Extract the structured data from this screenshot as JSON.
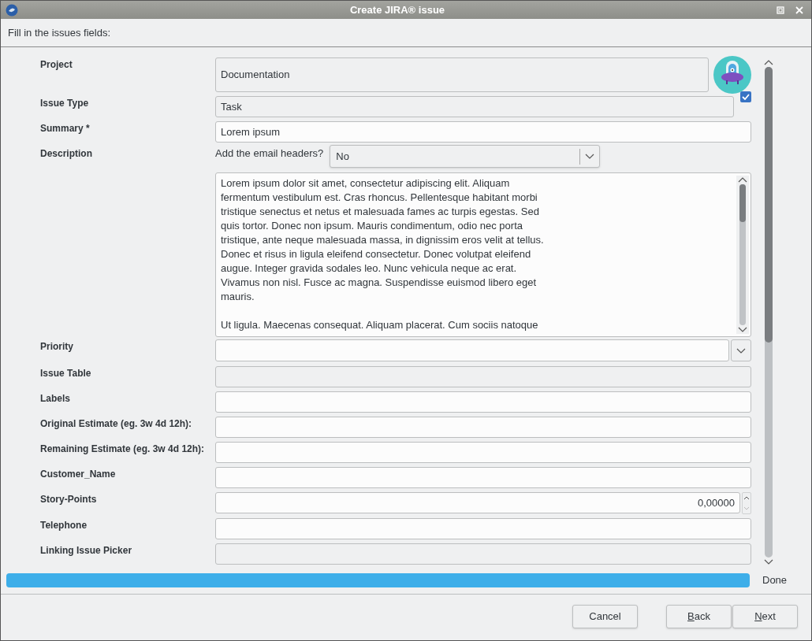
{
  "window": {
    "title": "Create JIRA® issue"
  },
  "instruction": "Fill in the issues fields:",
  "fields": [
    {
      "label": "Project",
      "kind": "readonly_tall",
      "value": "Documentation"
    },
    {
      "label": "Issue Type",
      "kind": "readonly_check",
      "value": "Task",
      "checked": true
    },
    {
      "label": "Summary *",
      "kind": "text",
      "value": "Lorem ipsum"
    },
    {
      "label": "Description",
      "kind": "description",
      "headers_label": "Add the email headers?",
      "headers_value": "No",
      "paragraphs": [
        "Lorem ipsum dolor sit amet, consectetur adipiscing elit. Aliquam fermentum vestibulum est. Cras rhoncus. Pellentesque habitant morbi tristique senectus et netus et malesuada fames ac turpis egestas. Sed quis tortor. Donec non ipsum. Mauris condimentum, odio nec porta tristique, ante neque malesuada massa, in dignissim eros velit at tellus. Donec et risus in ligula eleifend consectetur. Donec volutpat eleifend augue. Integer gravida sodales leo. Nunc vehicula neque ac erat. Vivamus non nisl. Fusce ac magna. Suspendisse euismod libero eget mauris.",
        "Ut ligula. Maecenas consequat. Aliquam placerat. Cum sociis natoque"
      ]
    },
    {
      "label": "Priority",
      "kind": "combo"
    },
    {
      "label": "Issue Table",
      "kind": "disabled"
    },
    {
      "label": "Labels",
      "kind": "text"
    },
    {
      "label": "Original Estimate (eg. 3w 4d 12h):",
      "kind": "text"
    },
    {
      "label": "Remaining Estimate (eg. 3w 4d 12h):",
      "kind": "text"
    },
    {
      "label": "Customer_Name",
      "kind": "text"
    },
    {
      "label": "Story-Points",
      "kind": "spin",
      "value": "0,00000"
    },
    {
      "label": "Telephone",
      "kind": "text"
    },
    {
      "label": "Linking Issue Picker",
      "kind": "disabled"
    }
  ],
  "progress": {
    "level": 1,
    "status": "Done"
  },
  "buttons": [
    {
      "label": "Cancel",
      "mnemonic": false
    },
    {
      "label": "Back",
      "mnemonic": true
    },
    {
      "label": "Next",
      "mnemonic": true
    }
  ]
}
